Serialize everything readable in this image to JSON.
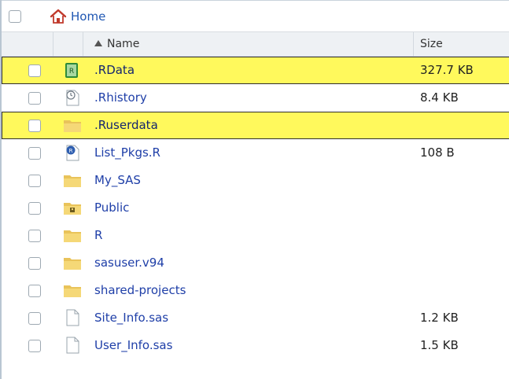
{
  "breadcrumb": {
    "home_label": "Home"
  },
  "columns": {
    "name_label": "Name",
    "size_label": "Size",
    "sort": "ascending"
  },
  "colors": {
    "highlight": "#fff95c",
    "link": "#1f3fa8",
    "folder": "#f0cf63"
  },
  "files": [
    {
      "name": ".RData",
      "size": "327.7 KB",
      "icon": "rdata-icon",
      "highlighted": true
    },
    {
      "name": ".Rhistory",
      "size": "8.4 KB",
      "icon": "history-icon",
      "highlighted": false
    },
    {
      "name": ".Ruserdata",
      "size": "",
      "icon": "folder-icon",
      "highlighted": true
    },
    {
      "name": "List_Pkgs.R",
      "size": "108 B",
      "icon": "r-script-icon",
      "highlighted": false
    },
    {
      "name": "My_SAS",
      "size": "",
      "icon": "folder-icon",
      "highlighted": false
    },
    {
      "name": "Public",
      "size": "",
      "icon": "public-folder-icon",
      "highlighted": false
    },
    {
      "name": "R",
      "size": "",
      "icon": "folder-icon",
      "highlighted": false
    },
    {
      "name": "sasuser.v94",
      "size": "",
      "icon": "folder-icon",
      "highlighted": false
    },
    {
      "name": "shared-projects",
      "size": "",
      "icon": "folder-icon",
      "highlighted": false
    },
    {
      "name": "Site_Info.sas",
      "size": "1.2 KB",
      "icon": "file-icon",
      "highlighted": false
    },
    {
      "name": "User_Info.sas",
      "size": "1.5 KB",
      "icon": "file-icon",
      "highlighted": false
    }
  ]
}
